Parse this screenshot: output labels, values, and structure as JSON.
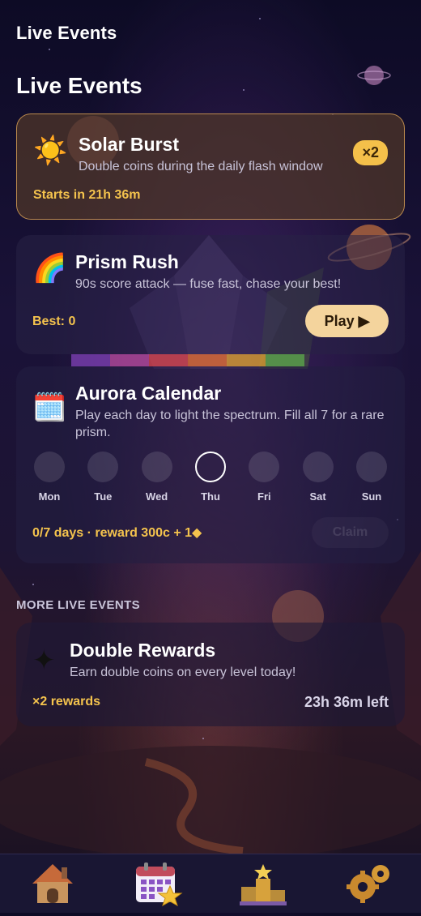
{
  "header": {
    "title": "Live Events"
  },
  "section": {
    "title": "Live Events"
  },
  "solar": {
    "icon": "sun-icon",
    "title": "Solar Burst",
    "subtitle": "Double coins during the daily flash window",
    "badge": "×2",
    "status": "Starts in 21h 36m"
  },
  "prism": {
    "icon": "rainbow-icon",
    "title": "Prism Rush",
    "subtitle": "90s score attack — fuse fast, chase your best!",
    "best": "Best: 0",
    "play_label": "Play ▶"
  },
  "aurora": {
    "icon": "calendar-icon",
    "title": "Aurora Calendar",
    "subtitle": "Play each day to light the spectrum. Fill all 7 for a rare prism.",
    "days": [
      {
        "label": "Mon"
      },
      {
        "label": "Tue"
      },
      {
        "label": "Wed"
      },
      {
        "label": "Thu"
      },
      {
        "label": "Fri"
      },
      {
        "label": "Sat"
      },
      {
        "label": "Sun"
      }
    ],
    "today_index": 3,
    "progress": "0/7 days · reward 300c + 1◆",
    "claim_label": "Claim"
  },
  "more": {
    "title": "MORE LIVE EVENTS"
  },
  "double": {
    "icon": "sparkle-icon",
    "title": "Double Rewards",
    "subtitle": "Earn double coins on every level today!",
    "reward": "×2 rewards",
    "time_left": "23h 36m left"
  },
  "nav": {
    "items": [
      "home-icon",
      "calendar-star-icon",
      "trophy-podium-icon",
      "gears-icon"
    ],
    "active_index": 1
  }
}
